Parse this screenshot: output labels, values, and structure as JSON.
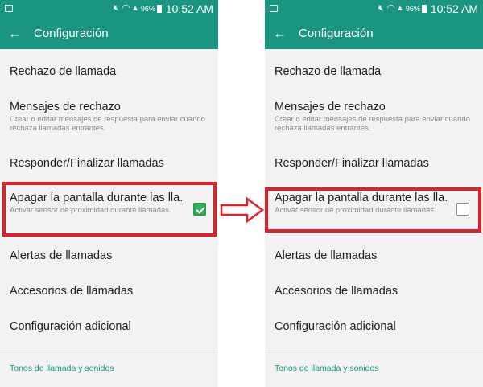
{
  "left": {
    "status": {
      "battery": "96%",
      "time": "10:52 AM"
    },
    "app_bar": {
      "title": "Configuración",
      "back_glyph": "←"
    },
    "items": {
      "rechazo": {
        "title": "Rechazo de llamada"
      },
      "mensajes": {
        "title": "Mensajes de rechazo",
        "subtitle": "Crear o editar mensajes de respuesta para enviar cuando rechaza llamadas entrantes."
      },
      "responder": {
        "title": "Responder/Finalizar llamadas"
      },
      "apagar": {
        "title": "Apagar la pantalla durante las lla..",
        "subtitle": "Activar sensor de proximidad durante llamadas.",
        "checked": true
      },
      "alertas": {
        "title": "Alertas de llamadas"
      },
      "accesorios": {
        "title": "Accesorios de llamadas"
      },
      "adicional": {
        "title": "Configuración adicional"
      }
    },
    "section": {
      "label": "Tonos de llamada y sonidos"
    }
  },
  "right": {
    "status": {
      "battery": "96%",
      "time": "10:52 AM"
    },
    "app_bar": {
      "title": "Configuración",
      "back_glyph": "←"
    },
    "items": {
      "rechazo": {
        "title": "Rechazo de llamada"
      },
      "mensajes": {
        "title": "Mensajes de rechazo",
        "subtitle": "Crear o editar mensajes de respuesta para enviar cuando rechaza llamadas entrantes."
      },
      "responder": {
        "title": "Responder/Finalizar llamadas"
      },
      "apagar": {
        "title": "Apagar la pantalla durante las lla..",
        "subtitle": "Activar sensor de proximidad durante llamadas.",
        "checked": false
      },
      "alertas": {
        "title": "Alertas de llamadas"
      },
      "accesorios": {
        "title": "Accesorios de llamadas"
      },
      "adicional": {
        "title": "Configuración adicional"
      }
    },
    "section": {
      "label": "Tonos de llamada y sonidos"
    }
  },
  "colors": {
    "header": "#1a9582",
    "highlight": "#e0202a",
    "checked": "#36b060",
    "link": "#1a9582"
  },
  "icons": [
    "gallery-icon",
    "mute-icon",
    "wifi-icon",
    "signal-icon",
    "battery-icon",
    "back-arrow-icon",
    "checkbox-checked-icon",
    "checkbox-unchecked-icon",
    "transition-arrow-icon"
  ]
}
